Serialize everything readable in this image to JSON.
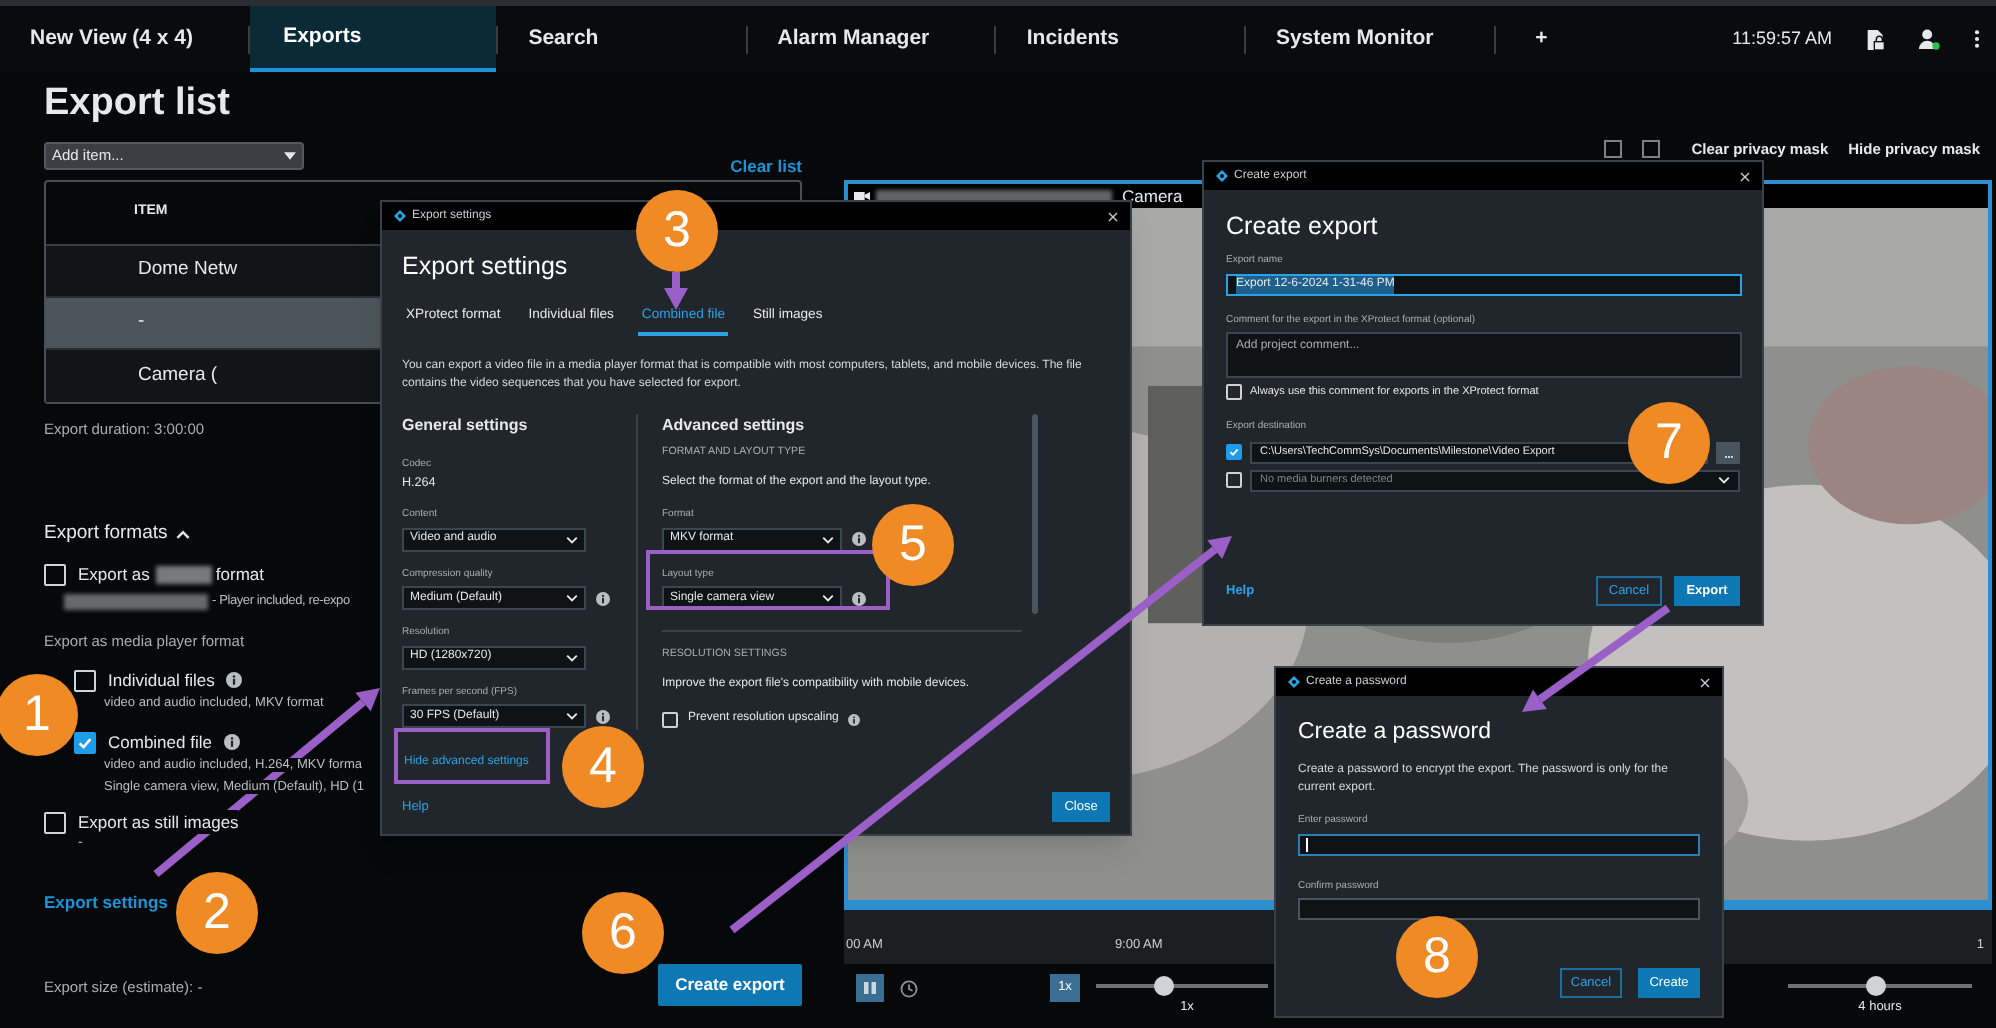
{
  "top_bar": {
    "tabs": [
      {
        "label": "New View (4 x 4)",
        "selected": false
      },
      {
        "label": "Exports",
        "selected": true
      },
      {
        "label": "Search",
        "selected": false
      },
      {
        "label": "Alarm Manager",
        "selected": false
      },
      {
        "label": "Incidents",
        "selected": false
      },
      {
        "label": "System Monitor",
        "selected": false
      },
      {
        "label": "+",
        "selected": false
      }
    ],
    "time": "11:59:57 AM"
  },
  "export_list": {
    "title": "Export list",
    "add_item": "Add item...",
    "clear_list": "Clear list",
    "column": "ITEM",
    "rows": [
      {
        "text": "Dome Netw",
        "selected": false
      },
      {
        "text": "-",
        "selected": true
      },
      {
        "text": "Camera (",
        "selected": false
      }
    ],
    "duration": "Export duration: 3:00:00"
  },
  "export_formats": {
    "title": "Export formats",
    "expanded": true,
    "xprotect_option": {
      "label": "Export as",
      "suffix": "format",
      "checked": false,
      "detail": "- Player included, re-expo"
    },
    "media_heading": "Export as media player format",
    "media_options": [
      {
        "label": "Individual files",
        "checked": false,
        "details": [
          "video and audio included, MKV format"
        ]
      },
      {
        "label": "Combined file",
        "checked": true,
        "details": [
          "video and audio included, H.264, MKV forma",
          "Single camera view, Medium (Default), HD (1"
        ]
      }
    ],
    "still_option": {
      "label": "Export as still images",
      "checked": false,
      "detail": "-"
    },
    "settings_link": "Export settings",
    "size": "Export size (estimate): -",
    "create_button": "Create export"
  },
  "video": {
    "clear_mask": "Clear privacy mask",
    "hide_mask": "Hide privacy mask",
    "camera_title": "Camera",
    "timeline_labels": [
      "00 AM",
      "9:00 AM",
      "1"
    ],
    "speed_button": "1x",
    "speed": "1x",
    "speed_slider": {
      "level": 0.38
    },
    "span": "4 hours",
    "span_slider": {
      "level": 0.48
    }
  },
  "export_settings": {
    "window_title": "Export settings",
    "title": "Export settings",
    "tabs": [
      {
        "label": "XProtect format",
        "selected": false
      },
      {
        "label": "Individual files",
        "selected": false
      },
      {
        "label": "Combined file",
        "selected": true
      },
      {
        "label": "Still images",
        "selected": false
      }
    ],
    "description": "You can export a video file in a media player format that is compatible with most computers, tablets, and mobile devices. The file contains the video sequences that you have selected for export.",
    "general_heading": "General settings",
    "codec_label": "Codec",
    "codec": "H.264",
    "general_fields": [
      {
        "label": "Content",
        "value": "Video and audio",
        "info": false
      },
      {
        "label": "Compression quality",
        "value": "Medium (Default)",
        "info": true
      },
      {
        "label": "Resolution",
        "value": "HD (1280x720)",
        "info": false
      },
      {
        "label": "Frames per second (FPS)",
        "value": "30 FPS (Default)",
        "info": true
      }
    ],
    "hide_advanced": "Hide advanced settings",
    "advanced_heading": "Advanced settings",
    "section_heading": "FORMAT AND LAYOUT TYPE",
    "section_text": "Select the format of the export and the layout type.",
    "advanced_fields": [
      {
        "label": "Format",
        "value": "MKV format",
        "info": true
      },
      {
        "label": "Layout type",
        "value": "Single camera view",
        "info": true
      }
    ],
    "resolution_heading": "RESOLUTION SETTINGS",
    "resolution_text": "Improve the export file's compatibility with mobile devices.",
    "prevent_upscaling": {
      "label": "Prevent resolution upscaling",
      "checked": false
    },
    "help": "Help",
    "close": "Close"
  },
  "create_export": {
    "window_title": "Create export",
    "title": "Create export",
    "name_label": "Export name",
    "name_value": "Export 12-6-2024 1-31-46 PM",
    "comment_label": "Comment for the export in the XProtect format (optional)",
    "comment_placeholder": "Add project comment...",
    "always_comment": {
      "label": "Always use this comment for exports in the XProtect format",
      "checked": false
    },
    "destination_label": "Export destination",
    "destinations": [
      {
        "kind": "folder",
        "text": "C:\\Users\\TechCommSys\\Documents\\Milestone\\Video Export",
        "checked": true
      },
      {
        "kind": "dropdown",
        "text": "No media burners detected",
        "checked": false
      }
    ],
    "help": "Help",
    "cancel": "Cancel",
    "export": "Export"
  },
  "create_password": {
    "window_title": "Create a password",
    "title": "Create a password",
    "text": "Create a password to encrypt the export. The password is only for the current export.",
    "fields": [
      {
        "label": "Enter password",
        "focused": true
      },
      {
        "label": "Confirm password",
        "focused": false
      }
    ],
    "cancel": "Cancel",
    "create": "Create"
  },
  "callouts": [
    {
      "number": "1"
    },
    {
      "number": "2"
    },
    {
      "number": "3"
    },
    {
      "number": "4"
    },
    {
      "number": "5"
    },
    {
      "number": "6"
    },
    {
      "number": "7"
    },
    {
      "number": "8"
    }
  ]
}
